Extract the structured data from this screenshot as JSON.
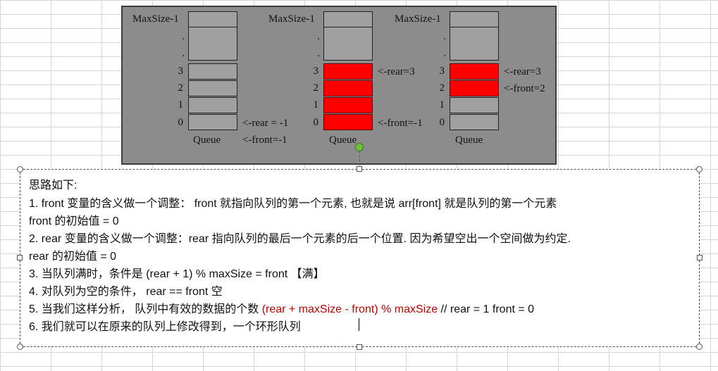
{
  "diagram": {
    "colors": {
      "filled": "#ff0000",
      "empty": "#a0a0a0",
      "background": "#8c8c8c"
    },
    "queues": [
      {
        "top_label": "MaxSize-1",
        "dot1": ".",
        "dot2": ".",
        "indices": [
          "3",
          "2",
          "1",
          "0"
        ],
        "name": "Queue",
        "filled": [],
        "pointers": [
          {
            "text": "<-rear = -1",
            "at": "0"
          },
          {
            "text": "<-front=-1",
            "at": "below"
          }
        ]
      },
      {
        "top_label": "MaxSize-1",
        "dot1": ".",
        "dot2": ".",
        "indices": [
          "3",
          "2",
          "1",
          "0"
        ],
        "name": "Queue",
        "filled": [
          "3",
          "2",
          "1",
          "0"
        ],
        "pointers": [
          {
            "text": "<-rear=3",
            "at": "3"
          },
          {
            "text": "<-front=-1",
            "at": "0"
          }
        ]
      },
      {
        "top_label": "MaxSize-1",
        "dot1": ".",
        "dot2": ".",
        "indices": [
          "3",
          "2",
          "1",
          "0"
        ],
        "name": "Queue",
        "filled": [
          "3",
          "2"
        ],
        "pointers": [
          {
            "text": "<-rear=3",
            "at": "3"
          },
          {
            "text": "<-front=2",
            "at": "2"
          }
        ]
      }
    ]
  },
  "notes": {
    "heading": "思路如下:",
    "l1": "1.  front 变量的含义做一个调整： front 就指向队列的第一个元素, 也就是说 arr[front] 就是队列的第一个元素",
    "l2": "front 的初始值 = 0",
    "l3": "2.  rear 变量的含义做一个调整：rear 指向队列的最后一个元素的后一个位置. 因为希望空出一个空间做为约定.",
    "l4": "rear 的初始值 = 0",
    "l5": "3. 当队列满时，条件是 (rear  + 1) % maxSize = front 【满】",
    "l6": "4. 对队列为空的条件， rear == front 空",
    "l7_prefix": "5. 当我们这样分析， 队列中有效的数据的个数 ",
    "l7_formula": " (rear + maxSize - front) % maxSize ",
    "l7_suffix": " // rear = 1 front = 0",
    "l8": "6. 我们就可以在原来的队列上修改得到，一个环形队列"
  }
}
